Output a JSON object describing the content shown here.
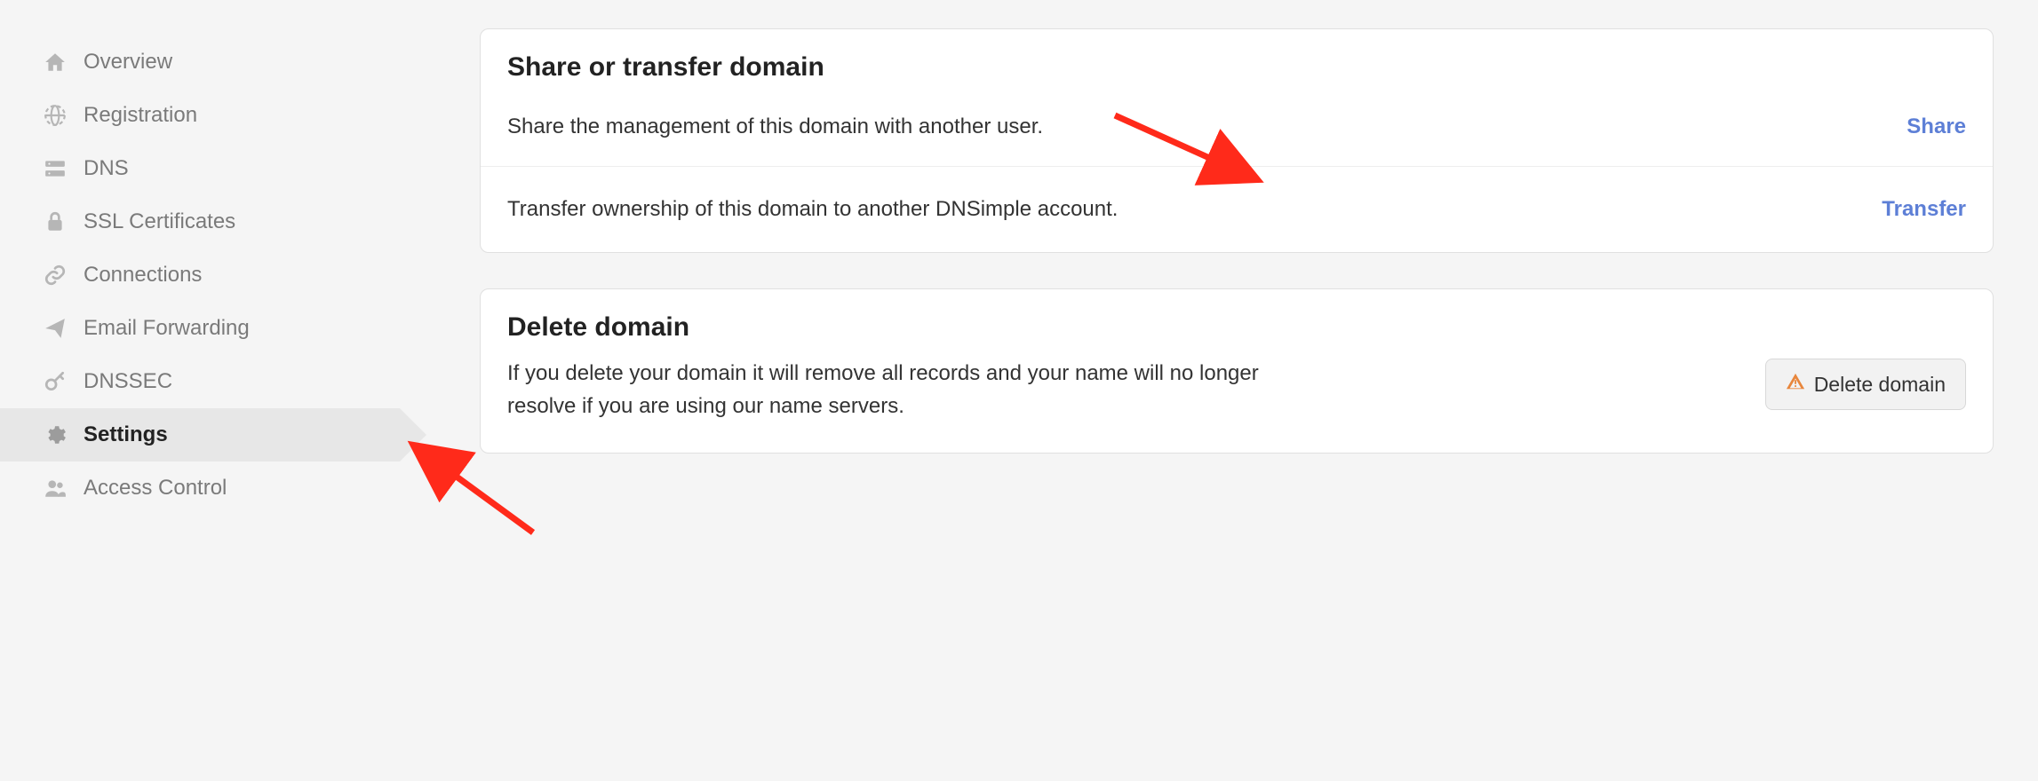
{
  "sidebar": {
    "items": [
      {
        "id": "overview",
        "label": "Overview",
        "icon": "home-icon",
        "active": false
      },
      {
        "id": "registration",
        "label": "Registration",
        "icon": "globe-icon",
        "active": false
      },
      {
        "id": "dns",
        "label": "DNS",
        "icon": "server-icon",
        "active": false
      },
      {
        "id": "ssl",
        "label": "SSL Certificates",
        "icon": "lock-icon",
        "active": false
      },
      {
        "id": "connections",
        "label": "Connections",
        "icon": "link-icon",
        "active": false
      },
      {
        "id": "email",
        "label": "Email Forwarding",
        "icon": "paper-plane-icon",
        "active": false
      },
      {
        "id": "dnssec",
        "label": "DNSSEC",
        "icon": "key-icon",
        "active": false
      },
      {
        "id": "settings",
        "label": "Settings",
        "icon": "gear-icon",
        "active": true
      },
      {
        "id": "access",
        "label": "Access Control",
        "icon": "users-icon",
        "active": false
      }
    ]
  },
  "share_card": {
    "title": "Share or transfer domain",
    "share_desc": "Share the management of this domain with another user.",
    "share_action": "Share",
    "transfer_desc": "Transfer ownership of this domain to another DNSimple account.",
    "transfer_action": "Transfer"
  },
  "delete_card": {
    "title": "Delete domain",
    "desc": "If you delete your domain it will remove all records and your name will no longer resolve if you are using our name servers.",
    "button_label": "Delete domain"
  },
  "annotations": {
    "arrow_transfer": true,
    "arrow_settings": true
  }
}
